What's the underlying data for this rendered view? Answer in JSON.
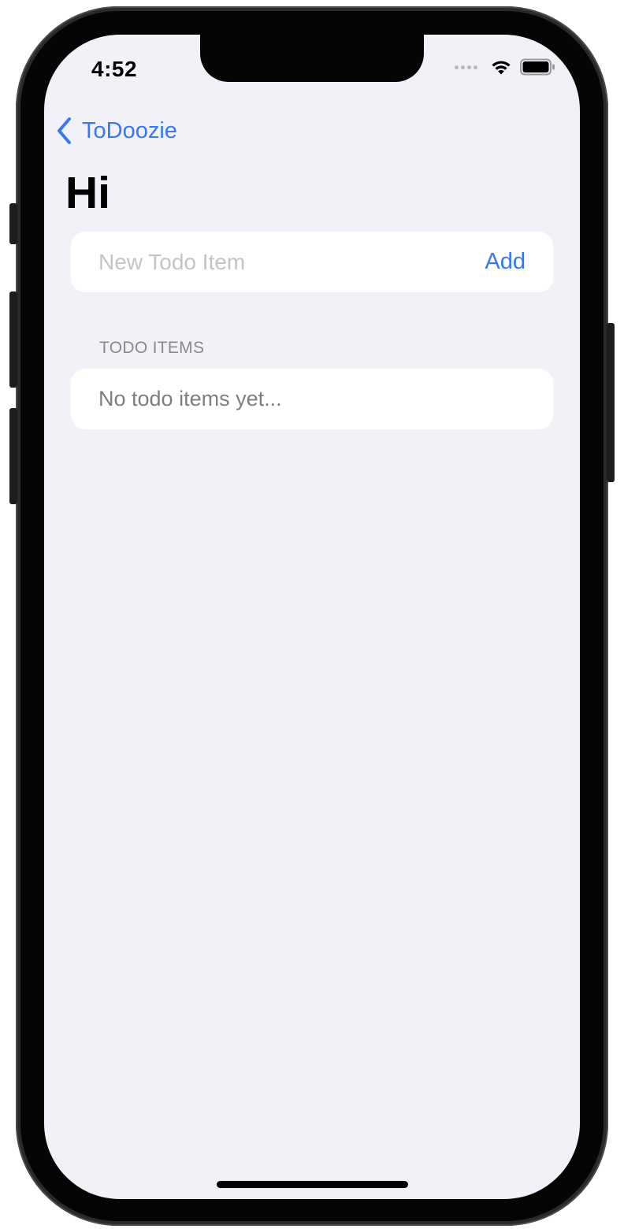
{
  "status_bar": {
    "time": "4:52",
    "icons": [
      "cellular-dots-icon",
      "wifi-icon",
      "battery-icon"
    ]
  },
  "nav": {
    "back_label": "ToDoozie",
    "back_icon": "chevron-left-icon"
  },
  "page": {
    "title": "Hi"
  },
  "new_item": {
    "placeholder": "New Todo Item",
    "value": "",
    "add_label": "Add"
  },
  "todo_list": {
    "section_header": "TODO ITEMS",
    "empty_message": "No todo items yet...",
    "items": []
  },
  "colors": {
    "accent": "#3478f6",
    "background": "#f2f1f7",
    "card": "#ffffff",
    "secondary_text": "#8a8a8e",
    "placeholder_text": "#c4c4c8"
  }
}
